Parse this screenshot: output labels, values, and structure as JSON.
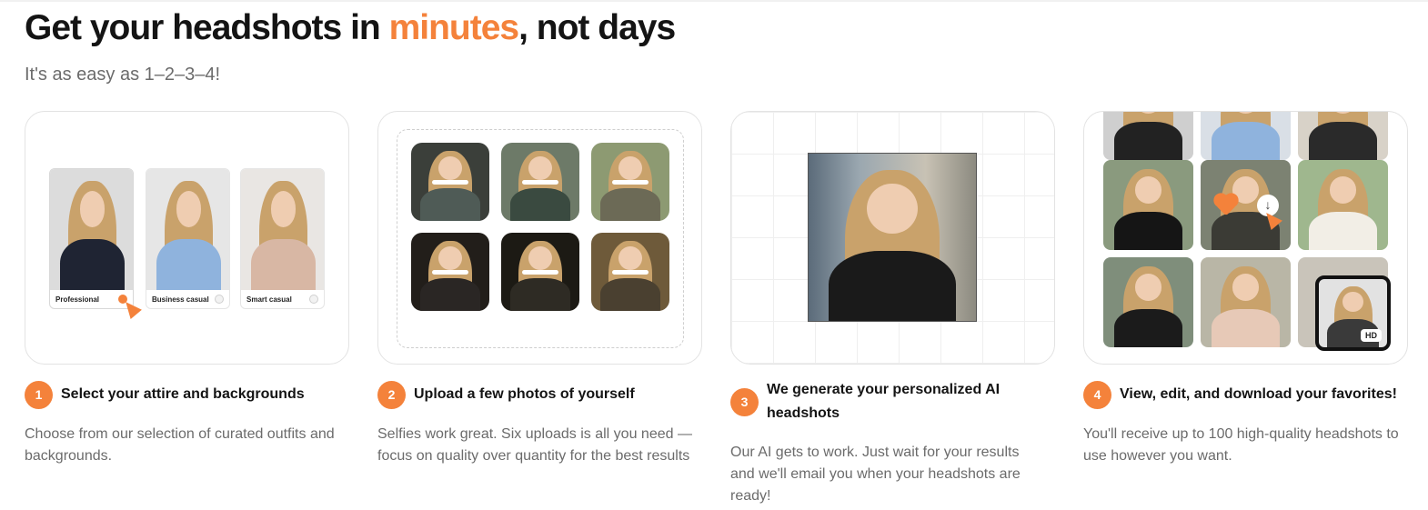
{
  "header": {
    "title_before": "Get your headshots in",
    "title_accent": "minutes",
    "title_after": ", not days",
    "subtitle": "It's as easy as 1–2–3–4!"
  },
  "colors": {
    "accent": "#f4823b",
    "text": "#141414",
    "muted": "#6b6b6b"
  },
  "card1": {
    "attires": [
      {
        "label": "Professional",
        "selected": true
      },
      {
        "label": "Business casual",
        "selected": false
      },
      {
        "label": "Smart casual",
        "selected": false
      }
    ]
  },
  "card4": {
    "hd_label": "HD"
  },
  "steps": [
    {
      "num": "1",
      "title": "Select your attire and backgrounds",
      "desc": "Choose from our selection of curated outfits and backgrounds."
    },
    {
      "num": "2",
      "title": "Upload a few photos of yourself",
      "desc": "Selfies work great. Six uploads is all you need — focus on quality over quantity for the best results"
    },
    {
      "num": "3",
      "title": "We generate your personalized AI headshots",
      "desc": "Our AI gets to work. Just wait for your results and we'll email you when your headshots are ready!"
    },
    {
      "num": "4",
      "title": "View, edit, and download your favorites!",
      "desc": "You'll receive up to 100 high-quality headshots to use however you want."
    }
  ]
}
